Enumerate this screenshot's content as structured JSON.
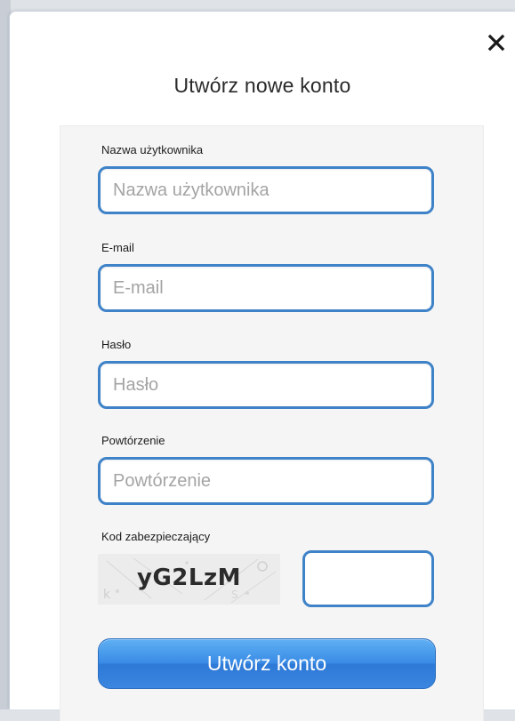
{
  "dialog": {
    "title": "Utwórz nowe konto",
    "close_icon": "close-icon"
  },
  "form": {
    "username": {
      "label": "Nazwa użytkownika",
      "placeholder": "Nazwa użytkownika",
      "value": ""
    },
    "email": {
      "label": "E-mail",
      "placeholder": "E-mail",
      "value": ""
    },
    "password": {
      "label": "Hasło",
      "placeholder": "Hasło",
      "value": ""
    },
    "password_repeat": {
      "label": "Powtórzenie",
      "placeholder": "Powtórzenie",
      "value": ""
    },
    "captcha": {
      "label": "Kod zabezpieczający",
      "code": "yG2LzM",
      "value": ""
    },
    "submit_label": "Utwórz konto"
  },
  "colors": {
    "accent": "#3e82c8",
    "button_top": "#5fb0f3",
    "button_bottom": "#2d79d6",
    "panel_bg": "#f5f5f5"
  }
}
